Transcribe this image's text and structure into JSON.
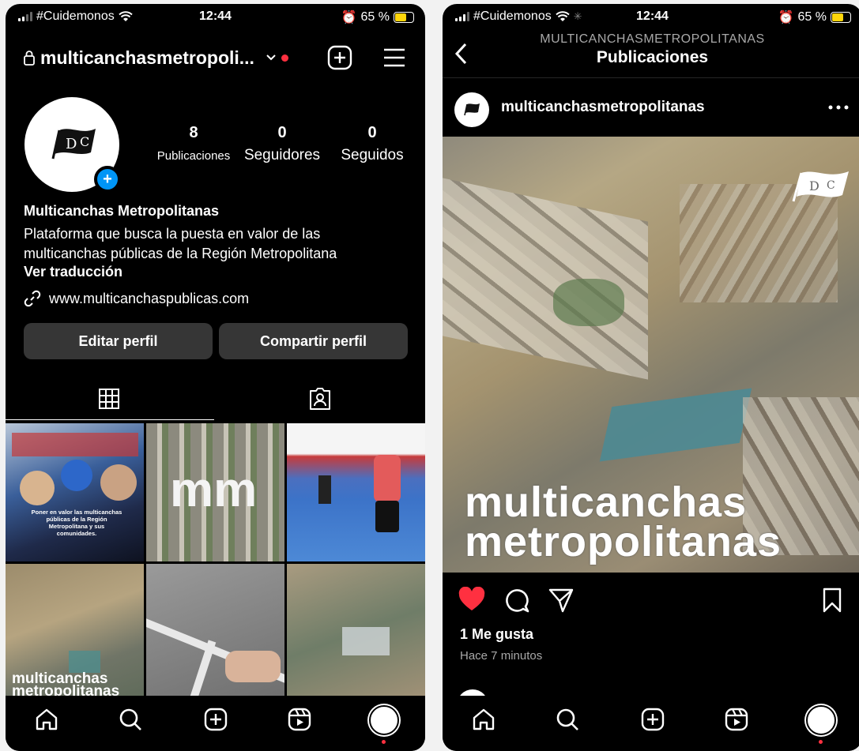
{
  "status": {
    "carrier": "#Cuidemonos",
    "time": "12:44",
    "battery": "65 %",
    "battery_color": "#ffd60a"
  },
  "profile": {
    "username": "multicanchasmetropoli...",
    "stats": [
      {
        "value": "8",
        "label": "Publicaciones"
      },
      {
        "value": "0",
        "label": "Seguidores"
      },
      {
        "value": "0",
        "label": "Seguidos"
      }
    ],
    "name": "Multicanchas Metropolitanas",
    "bio": "Plataforma que busca la puesta en valor de las multicanchas públicas de la Región Metropolitana",
    "translate": "Ver traducción",
    "link": "www.multicanchaspublicas.com",
    "edit_button": "Editar perfil",
    "share_button": "Compartir perfil",
    "grid_captions": {
      "post1": "Poner en valor las multicanchas públicas de la Región Metropolitana y sus comunidades.",
      "post2": "mm",
      "post4": "multicanchas metropolitanas"
    }
  },
  "post": {
    "account_upper": "MULTICANCHASMETROPOLITANAS",
    "title": "Publicaciones",
    "username": "multicanchasmetropolitanas",
    "image_caption_line1": "multicanchas",
    "image_caption_line2": "metropolitanas",
    "likes": "1 Me gusta",
    "time_ago": "Hace 7 minutos"
  },
  "colors": {
    "accent_blue": "#0095f6",
    "like_red": "#ff3040",
    "button_gray": "#363636"
  },
  "icons": {
    "header": [
      "lock-icon",
      "chevron-down-icon",
      "create-plus-icon",
      "menu-icon"
    ],
    "nav": [
      "home-icon",
      "search-icon",
      "create-icon",
      "reels-icon",
      "profile-avatar-icon"
    ],
    "post_actions": [
      "heart-icon",
      "comment-icon",
      "share-icon",
      "bookmark-icon"
    ]
  }
}
